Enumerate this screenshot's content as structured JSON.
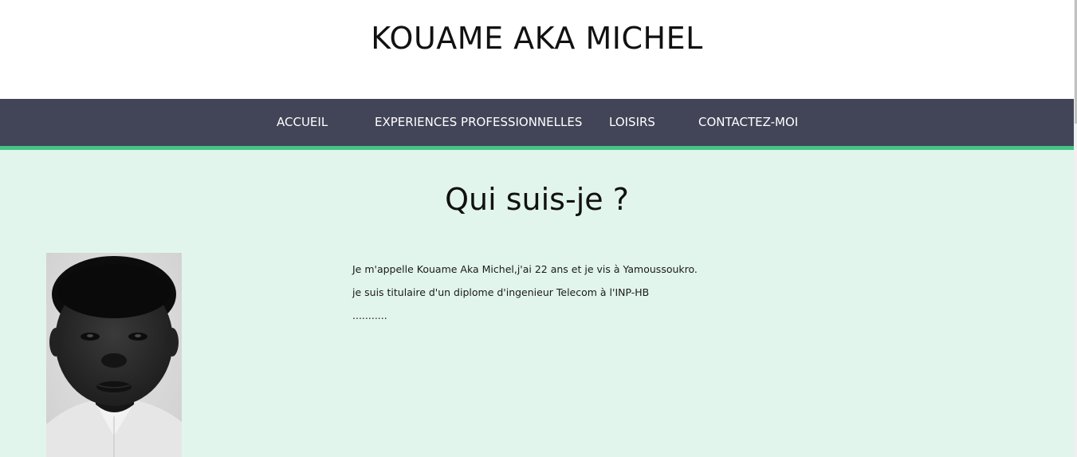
{
  "header": {
    "title": "KOUAME AKA MICHEL"
  },
  "nav": {
    "items": [
      {
        "label": "ACCUEIL"
      },
      {
        "label": "EXPERIENCES PROFESSIONNELLES"
      },
      {
        "label": "LOISIRS"
      },
      {
        "label": "CONTACTEZ-MOI"
      }
    ]
  },
  "main": {
    "title": "Qui suis-je ?",
    "bio": {
      "line1": "Je m'appelle Kouame Aka Michel,j'ai 22 ans et je vis à Yamoussoukro.",
      "line2": "je suis titulaire d'un diplome d'ingenieur Telecom à l'INP-HB",
      "line3": "..........."
    },
    "photo_icon": "profile-photo"
  },
  "colors": {
    "nav_bg": "#424557",
    "nav_accent": "#45c486",
    "main_bg": "#e2f5ec"
  }
}
